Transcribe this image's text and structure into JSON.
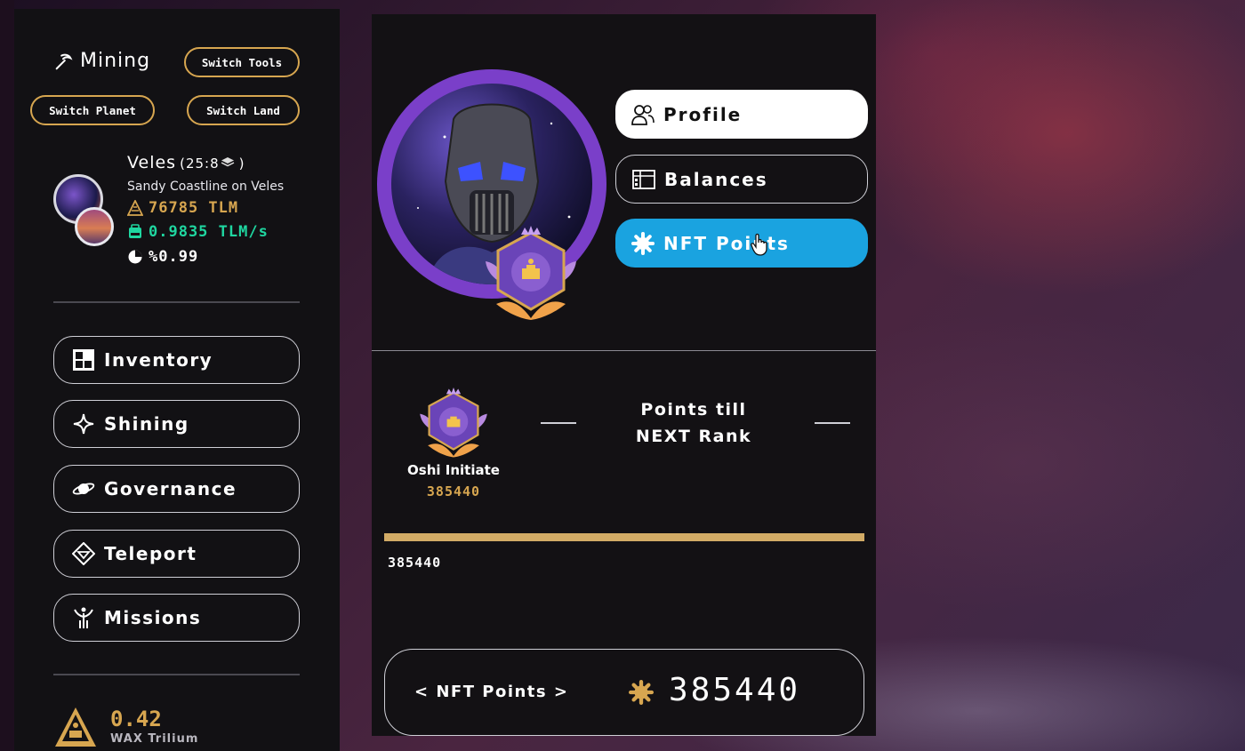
{
  "colors": {
    "gold": "#d7a650",
    "green": "#1fd6a0",
    "blue": "#1aa3e0",
    "purple": "#7a3fc9"
  },
  "sidebar": {
    "mining_label": "Mining",
    "switch_tools": "Switch Tools",
    "switch_planet": "Switch Planet",
    "switch_land": "Switch Land",
    "planet": {
      "name": "Veles",
      "coords": "(25:8"
    },
    "land_name": "Sandy Coastline on Veles",
    "tlm_amount": "76785 TLM",
    "tlm_rate": "0.9835 TLM/s",
    "commission": "%0.99",
    "nav": [
      {
        "label": "Inventory",
        "icon": "inventory-grid-icon"
      },
      {
        "label": "Shining",
        "icon": "sparkle-icon"
      },
      {
        "label": "Governance",
        "icon": "planet-ring-icon"
      },
      {
        "label": "Teleport",
        "icon": "teleport-icon"
      },
      {
        "label": "Missions",
        "icon": "missions-icon"
      }
    ],
    "wax_value": "0.42",
    "wax_label": "WAX Trilium"
  },
  "tabs": {
    "profile": "Profile",
    "balances": "Balances",
    "nft_points": "NFT Points"
  },
  "rank": {
    "name": "Oshi Initiate",
    "points": "385440",
    "next_title_line1": "Points till",
    "next_title_line2": "NEXT Rank"
  },
  "progress": {
    "fraction": 1.0,
    "label": "385440"
  },
  "points_box": {
    "label": "< NFT Points >",
    "value": "385440"
  }
}
